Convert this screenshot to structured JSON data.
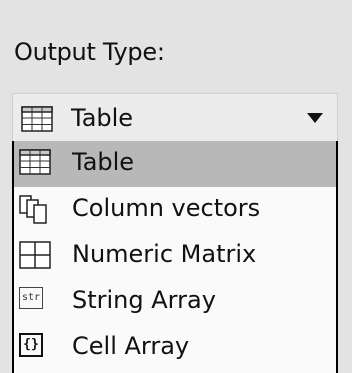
{
  "output_type": {
    "label": "Output Type:",
    "selected_value": "Table",
    "selected_icon": "table-icon",
    "options": [
      {
        "label": "Table",
        "icon": "table-icon",
        "selected": true
      },
      {
        "label": "Column vectors",
        "icon": "column-vectors-icon",
        "selected": false
      },
      {
        "label": "Numeric Matrix",
        "icon": "numeric-matrix-icon",
        "selected": false
      },
      {
        "label": "String Array",
        "icon": "string-array-icon",
        "icon_text": "str",
        "selected": false
      },
      {
        "label": "Cell Array",
        "icon": "cell-array-icon",
        "icon_text": "{}",
        "selected": false
      }
    ]
  }
}
